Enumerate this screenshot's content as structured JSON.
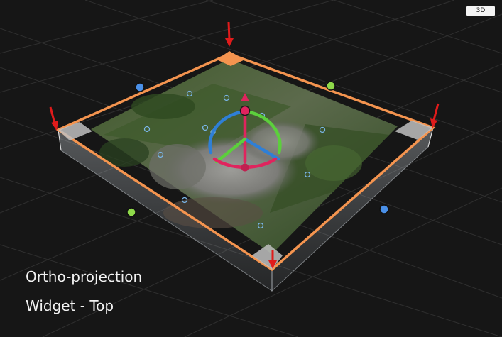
{
  "view_mode_label": "3D",
  "caption": {
    "line1": "Ortho-projection",
    "line2": "Widget - Top"
  },
  "colors": {
    "background": "#161616",
    "grid_line": "#2f2f2f",
    "box_outline": "#f4944f",
    "arrow": "#e01b1b",
    "gizmo_red": "#e0245e",
    "gizmo_green": "#5ccf3c",
    "gizmo_blue": "#2f7fd6",
    "handle_green": "#8fd94a",
    "handle_blue": "#4a90e8"
  },
  "icons": [
    "down-arrow-icon",
    "rotate-gizmo-icon",
    "resize-handle-icon"
  ]
}
